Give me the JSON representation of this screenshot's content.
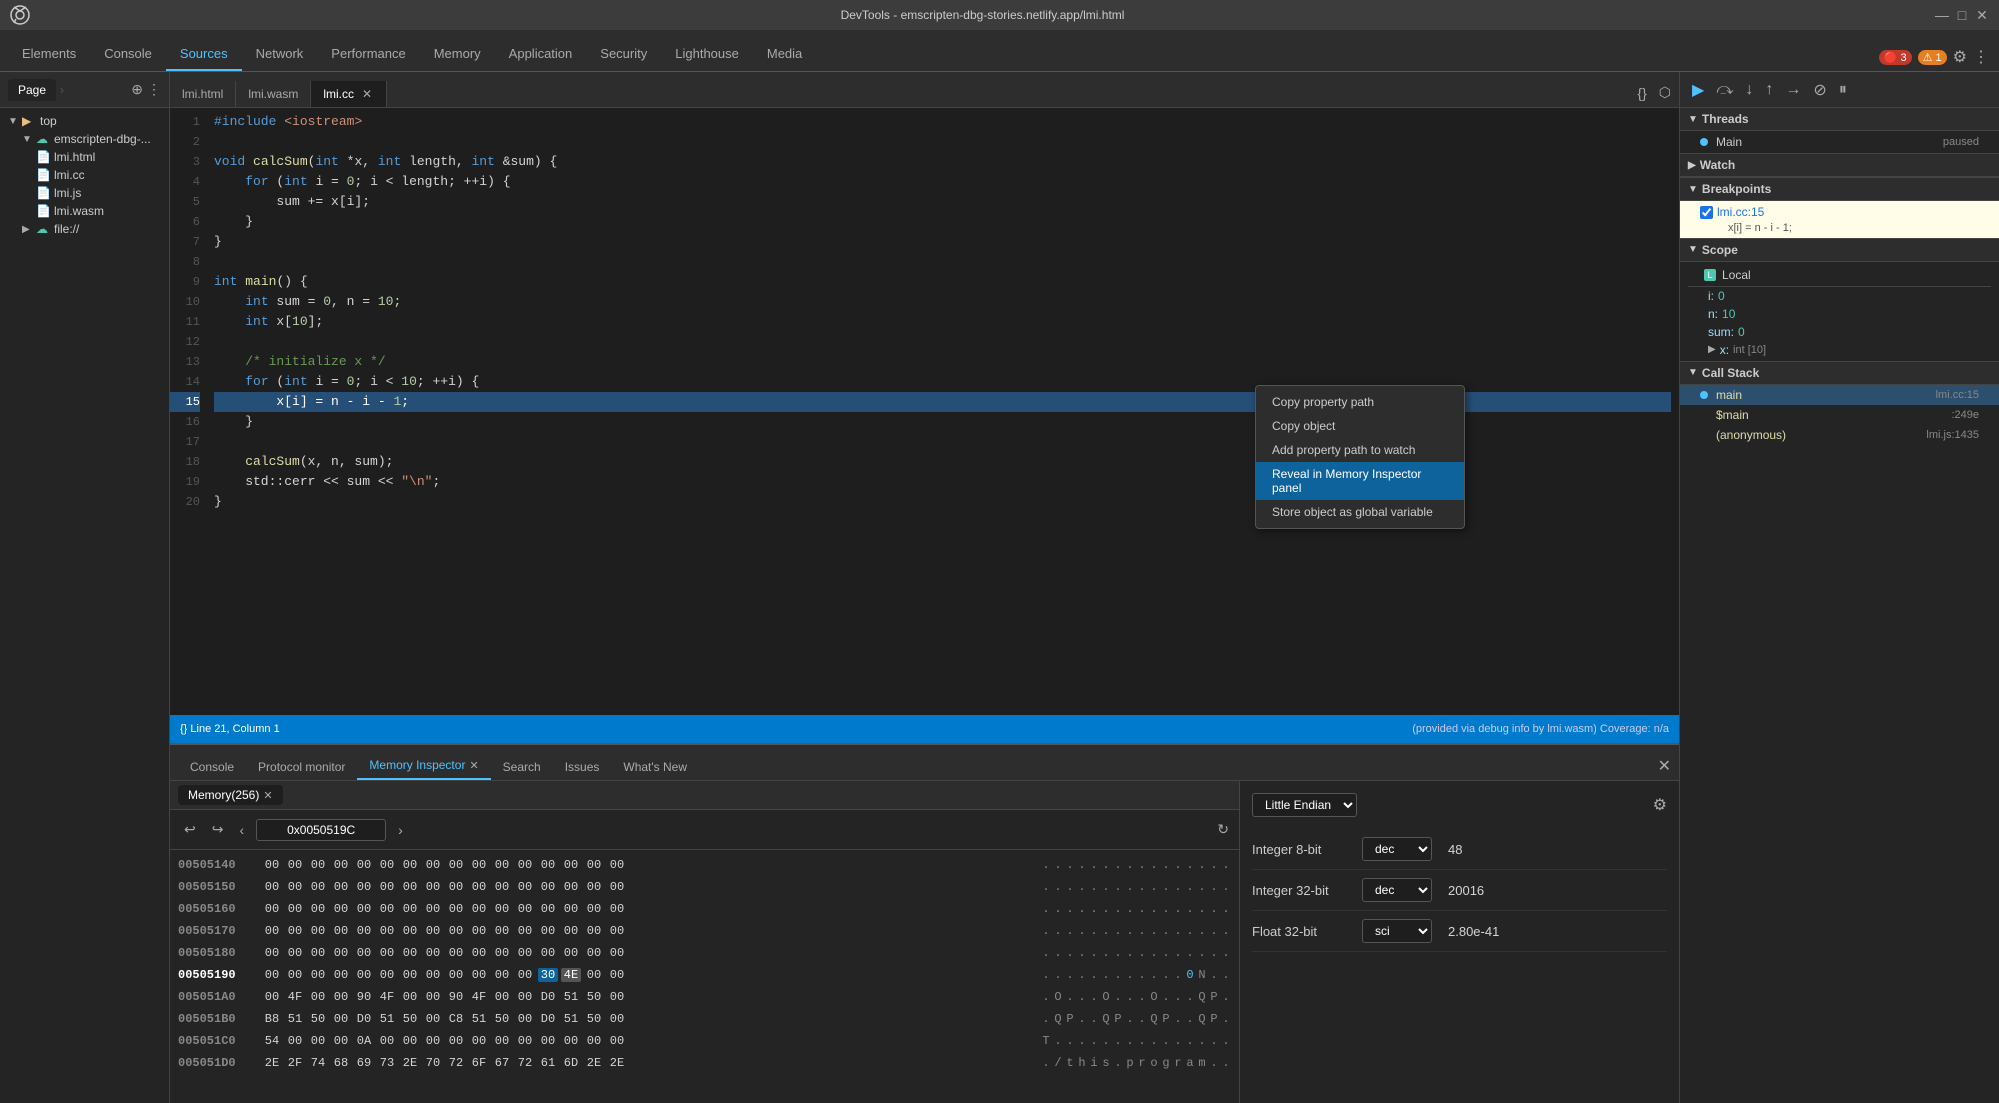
{
  "titlebar": {
    "title": "DevTools - emscripten-dbg-stories.netlify.app/lmi.html",
    "minimize": "—",
    "maximize": "□",
    "close": "✕"
  },
  "main_tabs": [
    {
      "label": "Elements",
      "active": false
    },
    {
      "label": "Console",
      "active": false
    },
    {
      "label": "Sources",
      "active": true
    },
    {
      "label": "Network",
      "active": false
    },
    {
      "label": "Performance",
      "active": false
    },
    {
      "label": "Memory",
      "active": false
    },
    {
      "label": "Application",
      "active": false
    },
    {
      "label": "Security",
      "active": false
    },
    {
      "label": "Lighthouse",
      "active": false
    },
    {
      "label": "Media",
      "active": false
    }
  ],
  "error_count": "3",
  "warn_count": "1",
  "page_tab": "Page",
  "sidebar_files": [
    {
      "indent": 0,
      "type": "folder",
      "label": "top",
      "expanded": true
    },
    {
      "indent": 1,
      "type": "cloud-folder",
      "label": "emscripten-dbg-...",
      "expanded": true
    },
    {
      "indent": 2,
      "type": "file",
      "label": "lmi.html",
      "selected": false
    },
    {
      "indent": 2,
      "type": "file",
      "label": "lmi.cc",
      "selected": false
    },
    {
      "indent": 2,
      "type": "file",
      "label": "lmi.js",
      "selected": false
    },
    {
      "indent": 2,
      "type": "file",
      "label": "lmi.wasm",
      "selected": false
    },
    {
      "indent": 1,
      "type": "cloud-folder",
      "label": "file://",
      "expanded": false
    }
  ],
  "editor_tabs": [
    {
      "label": "lmi.html",
      "closable": false,
      "active": false
    },
    {
      "label": "lmi.wasm",
      "closable": false,
      "active": false
    },
    {
      "label": "lmi.cc",
      "closable": true,
      "active": true
    }
  ],
  "code_lines": [
    {
      "num": 1,
      "text": "#include <iostream>"
    },
    {
      "num": 2,
      "text": ""
    },
    {
      "num": 3,
      "text": "void calcSum(int *x, int length, int &sum) {"
    },
    {
      "num": 4,
      "text": "    for (int i = 0; i < length; ++i) {"
    },
    {
      "num": 5,
      "text": "        sum += x[i];"
    },
    {
      "num": 6,
      "text": "    }"
    },
    {
      "num": 7,
      "text": "}"
    },
    {
      "num": 8,
      "text": ""
    },
    {
      "num": 9,
      "text": "int main() {"
    },
    {
      "num": 10,
      "text": "    int sum = 0, n = 10;"
    },
    {
      "num": 11,
      "text": "    int x[10];"
    },
    {
      "num": 12,
      "text": ""
    },
    {
      "num": 13,
      "text": "    /* initialize x */"
    },
    {
      "num": 14,
      "text": "    for (int i = 0; i < 10; ++i) {"
    },
    {
      "num": 15,
      "text": "        x[i] = n - i - 1;",
      "highlighted": true
    },
    {
      "num": 16,
      "text": "    }"
    },
    {
      "num": 17,
      "text": ""
    },
    {
      "num": 18,
      "text": "    calcSum(x, n, sum);"
    },
    {
      "num": 19,
      "text": "    std::cerr << sum << \"\\n\";"
    },
    {
      "num": 20,
      "text": "}"
    }
  ],
  "status_bar": {
    "left": "{}  Line 21, Column 1",
    "right": "(provided via debug info by lmi.wasm)  Coverage: n/a"
  },
  "debugger": {
    "threads_label": "Threads",
    "main_thread": "Main",
    "main_status": "paused",
    "watch_label": "Watch",
    "breakpoints_label": "Breakpoints",
    "breakpoint_file": "lmi.cc:15",
    "breakpoint_code": "x[i] = n - i - 1;",
    "scope_label": "Scope",
    "local_label": "Local",
    "scope_items": [
      {
        "key": "i:",
        "val": "0"
      },
      {
        "key": "n:",
        "val": "10"
      },
      {
        "key": "sum:",
        "val": "0"
      }
    ],
    "scope_expand": {
      "key": "x:",
      "type": "int [10]"
    },
    "callstack_label": "Call Stack",
    "callstack_items": [
      {
        "name": "main",
        "loc": "lmi.cc:15",
        "active": true
      },
      {
        "name": "$main",
        "loc": ":249e",
        "active": false
      },
      {
        "name": "(anonymous)",
        "loc": "lmi.js:1435",
        "active": false
      }
    ]
  },
  "context_menu": {
    "items": [
      {
        "label": "Copy property path",
        "highlighted": false
      },
      {
        "label": "Copy object",
        "highlighted": false
      },
      {
        "label": "Add property path to watch",
        "highlighted": false
      },
      {
        "label": "Reveal in Memory Inspector panel",
        "highlighted": true
      },
      {
        "label": "Store object as global variable",
        "highlighted": false
      }
    ]
  },
  "bottom_tabs": [
    {
      "label": "Console",
      "active": false,
      "closable": false
    },
    {
      "label": "Protocol monitor",
      "active": false,
      "closable": false
    },
    {
      "label": "Memory Inspector",
      "active": true,
      "closable": true
    },
    {
      "label": "Search",
      "active": false,
      "closable": false
    },
    {
      "label": "Issues",
      "active": false,
      "closable": false
    },
    {
      "label": "What's New",
      "active": false,
      "closable": false
    }
  ],
  "memory_inspector": {
    "tab_label": "Memory(256)",
    "address": "0x0050519C",
    "endian": "Little Endian",
    "rows": [
      {
        "addr": "00505140",
        "bytes": [
          "00",
          "00",
          "00",
          "00",
          "00",
          "00",
          "00",
          "00",
          "00",
          "00",
          "00",
          "00",
          "00",
          "00",
          "00",
          "00"
        ],
        "ascii": "................",
        "current": false
      },
      {
        "addr": "00505150",
        "bytes": [
          "00",
          "00",
          "00",
          "00",
          "00",
          "00",
          "00",
          "00",
          "00",
          "00",
          "00",
          "00",
          "00",
          "00",
          "00",
          "00"
        ],
        "ascii": "................",
        "current": false
      },
      {
        "addr": "00505160",
        "bytes": [
          "00",
          "00",
          "00",
          "00",
          "00",
          "00",
          "00",
          "00",
          "00",
          "00",
          "00",
          "00",
          "00",
          "00",
          "00",
          "00"
        ],
        "ascii": "................",
        "current": false
      },
      {
        "addr": "00505170",
        "bytes": [
          "00",
          "00",
          "00",
          "00",
          "00",
          "00",
          "00",
          "00",
          "00",
          "00",
          "00",
          "00",
          "00",
          "00",
          "00",
          "00"
        ],
        "ascii": "................",
        "current": false
      },
      {
        "addr": "00505180",
        "bytes": [
          "00",
          "00",
          "00",
          "00",
          "00",
          "00",
          "00",
          "00",
          "00",
          "00",
          "00",
          "00",
          "00",
          "00",
          "00",
          "00"
        ],
        "ascii": "................",
        "current": false
      },
      {
        "addr": "00505190",
        "bytes": [
          "00",
          "00",
          "00",
          "00",
          "00",
          "00",
          "00",
          "00",
          "00",
          "00",
          "00",
          "00",
          "30",
          "4E",
          "00",
          "00"
        ],
        "ascii": ". . . . . . . . . . . . 0 N . .",
        "current": true,
        "highlight_byte": 12,
        "highlight2_byte": 13
      },
      {
        "addr": "005051A0",
        "bytes": [
          "00",
          "4F",
          "00",
          "00",
          "90",
          "4F",
          "00",
          "00",
          "90",
          "4F",
          "00",
          "00",
          "D0",
          "51",
          "50",
          "00"
        ],
        "ascii": ". O . . . O . . . O . . . Q P .",
        "current": false
      },
      {
        "addr": "005051B0",
        "bytes": [
          "B8",
          "51",
          "50",
          "00",
          "D0",
          "51",
          "50",
          "00",
          "C8",
          "51",
          "50",
          "00",
          "D0",
          "51",
          "50",
          "00"
        ],
        "ascii": ". Q P . . Q P . . Q P . . Q P .",
        "current": false
      },
      {
        "addr": "005051C0",
        "bytes": [
          "54",
          "00",
          "00",
          "00",
          "0A",
          "00",
          "00",
          "00",
          "00",
          "00",
          "00",
          "00",
          "00",
          "00",
          "00",
          "00"
        ],
        "ascii": "T . . . . . . . . . . . . . . .",
        "current": false
      },
      {
        "addr": "005051D0",
        "bytes": [
          "2E",
          "2F",
          "74",
          "68",
          "69",
          "73",
          "2E",
          "70",
          "72",
          "6F",
          "67",
          "72",
          "61",
          "6D",
          "2E",
          "2E"
        ],
        "ascii": ". / t h i s . p r o g r a m . .",
        "current": false
      }
    ],
    "types": [
      {
        "label": "Integer 8-bit",
        "format": "dec",
        "value": "48"
      },
      {
        "label": "Integer 32-bit",
        "format": "dec",
        "value": "20016"
      },
      {
        "label": "Float 32-bit",
        "format": "sci",
        "value": "2.80e-41"
      }
    ]
  }
}
